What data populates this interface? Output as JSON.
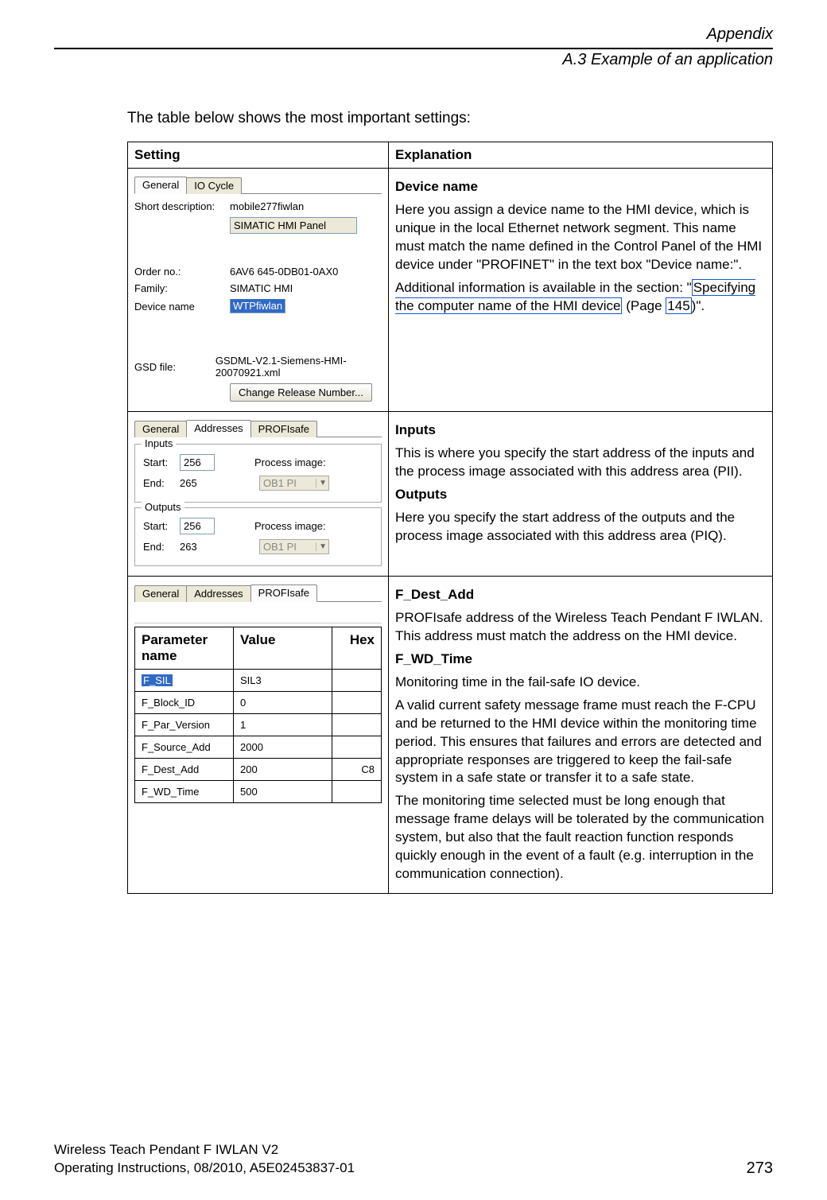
{
  "header": {
    "breadcrumb": "Appendix",
    "subtitle": "A.3 Example of an application"
  },
  "intro": "The table below shows the most important settings:",
  "table": {
    "head": {
      "setting": "Setting",
      "explanation": "Explanation"
    }
  },
  "row1": {
    "tabs": {
      "general": "General",
      "iocycle": "IO Cycle"
    },
    "shortdesc_lbl": "Short description:",
    "shortdesc_val": "mobile277fiwlan",
    "longname_val": "SIMATIC HMI Panel",
    "orderno_lbl": "Order no.:",
    "orderno_val": "6AV6 645-0DB01-0AX0",
    "family_lbl": "Family:",
    "family_val": "SIMATIC HMI",
    "devname_lbl": "Device name",
    "devname_val": "WTPfiwlan",
    "gsdfile_lbl": "GSD file:",
    "gsdfile_val": "GSDML-V2.1-Siemens-HMI-20070921.xml",
    "btn_change": "Change Release Number...",
    "expl": {
      "h": "Device name",
      "p1": "Here you assign a device name to the HMI device, which is unique in the local Ethernet network segment. This name must match the name defined in the Control Panel of the HMI device under \"PROFINET\" in the text box \"Device name:\".",
      "p2a": "Additional information is available in the section: \"",
      "link": "Specifying the computer name of the HMI device",
      "p2b": " (Page ",
      "page": "145",
      "p2c": ")\"."
    }
  },
  "row2": {
    "tabs": {
      "general": "General",
      "addresses": "Addresses",
      "profisafe": "PROFIsafe"
    },
    "inputs_legend": "Inputs",
    "outputs_legend": "Outputs",
    "start_lbl": "Start:",
    "end_lbl": "End:",
    "pi_lbl": "Process image:",
    "in_start": "256",
    "in_end": "265",
    "in_pi": "OB1 PI",
    "out_start": "256",
    "out_end": "263",
    "out_pi": "OB1 PI",
    "expl": {
      "h1": "Inputs",
      "p1": "This is where you specify the start address of the inputs and the process image associated with this address area (PII).",
      "h2": "Outputs",
      "p2": "Here you specify the start address of the outputs and the process image associated with this address area (PIQ)."
    }
  },
  "row3": {
    "tabs": {
      "general": "General",
      "addresses": "Addresses",
      "profisafe": "PROFIsafe"
    },
    "th_param": "Parameter name",
    "th_value": "Value",
    "th_hex": "Hex",
    "params": [
      {
        "n": "F_SIL",
        "v": "SIL3",
        "h": ""
      },
      {
        "n": "F_Block_ID",
        "v": "0",
        "h": ""
      },
      {
        "n": "F_Par_Version",
        "v": "1",
        "h": ""
      },
      {
        "n": "F_Source_Add",
        "v": "2000",
        "h": ""
      },
      {
        "n": "F_Dest_Add",
        "v": "200",
        "h": "C8"
      },
      {
        "n": "F_WD_Time",
        "v": "500",
        "h": ""
      }
    ],
    "expl": {
      "h1": "F_Dest_Add",
      "p1": "PROFIsafe address of the Wireless Teach Pendant F IWLAN. This address must match the address on the HMI device.",
      "h2": "F_WD_Time",
      "p2": "Monitoring time in the fail-safe IO device.",
      "p3": "A valid current safety message frame must reach the F-CPU and be returned to the HMI device within the monitoring time period. This ensures that failures and errors are detected and appropriate responses are triggered to keep the fail-safe system in a safe state or transfer it to a safe state.",
      "p4": "The monitoring time selected must be long enough that message frame delays will be tolerated by the communication system, but also that the fault reaction function responds quickly enough in the event of a fault (e.g. interruption in the communication connection)."
    }
  },
  "footer": {
    "line1": "Wireless Teach Pendant F IWLAN V2",
    "line2": "Operating Instructions, 08/2010, A5E02453837-01",
    "page": "273"
  }
}
